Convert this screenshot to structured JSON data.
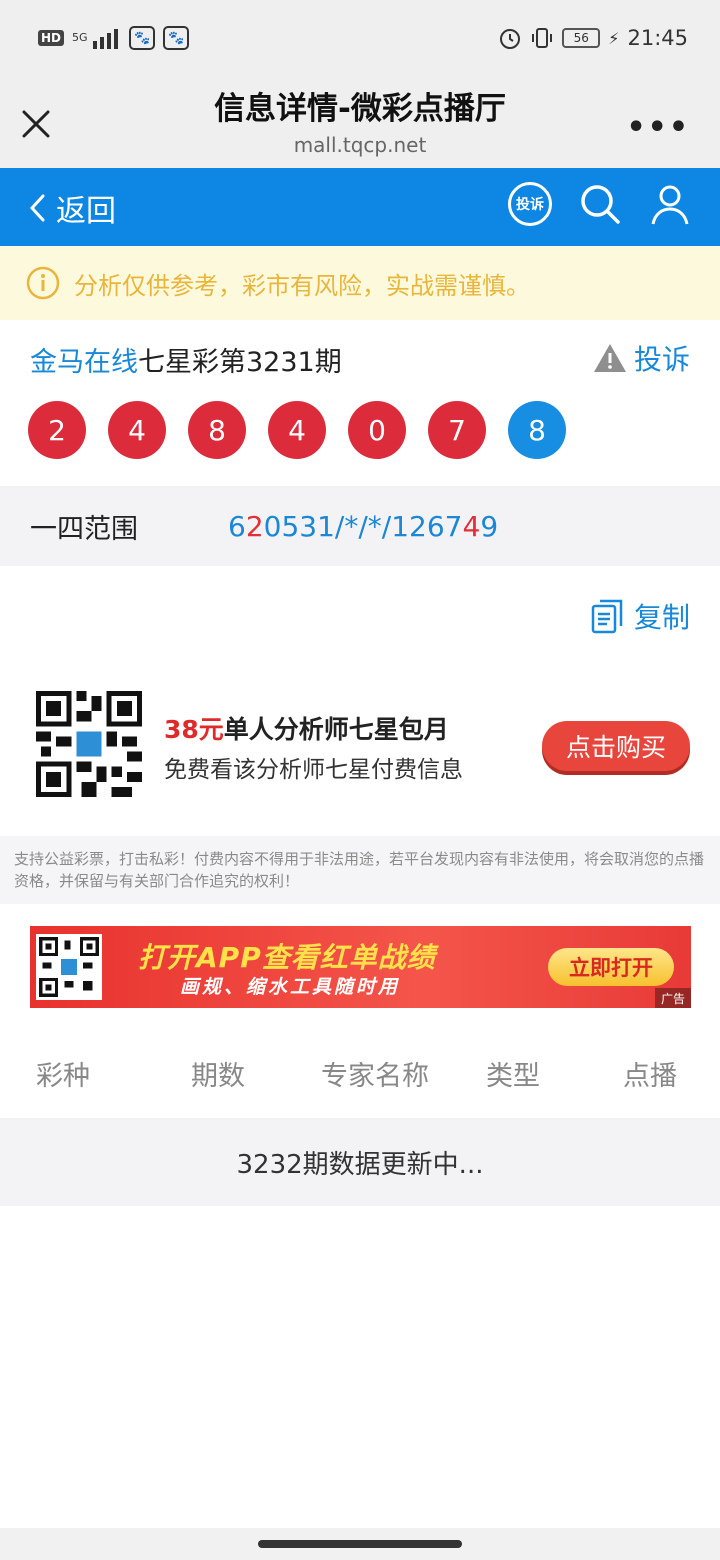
{
  "status_bar": {
    "hd": "HD",
    "network": "5G",
    "time": "21:45",
    "battery": "56"
  },
  "browser": {
    "title": "信息详情-微彩点播厅",
    "url": "mall.tqcp.net",
    "more": "•••"
  },
  "nav": {
    "back_label": "返回",
    "complain_icon_label": "投诉"
  },
  "notice": {
    "text": "分析仅供参考，彩市有风险，实战需谨慎。"
  },
  "lottery": {
    "source": "金马在线",
    "title": "七星彩第3231期",
    "report_label": "投诉",
    "balls": [
      {
        "value": "2",
        "color": "#dc2c3c"
      },
      {
        "value": "4",
        "color": "#dc2c3c"
      },
      {
        "value": "8",
        "color": "#dc2c3c"
      },
      {
        "value": "4",
        "color": "#dc2c3c"
      },
      {
        "value": "0",
        "color": "#dc2c3c"
      },
      {
        "value": "7",
        "color": "#dc2c3c"
      },
      {
        "value": "8",
        "color": "#178ee2"
      }
    ]
  },
  "range": {
    "label": "一四范围",
    "value_part1": "6",
    "value_part2": "2",
    "value_part3": "0531/*/*/1267",
    "value_part4": "4",
    "value_part5": "9"
  },
  "copy": {
    "label": "复制"
  },
  "promo": {
    "price": "38元",
    "title": "单人分析师七星包月",
    "subtitle": "免费看该分析师七星付费信息",
    "buy_label": "点击购买"
  },
  "disclaimer": "支持公益彩票，打击私彩！付费内容不得用于非法用途，若平台发现内容有非法使用，将会取消您的点播资格，并保留与有关部门合作追究的权利！",
  "banner": {
    "line1": "打开APP查看红单战绩",
    "line2": "画规、缩水工具随时用",
    "button": "立即打开",
    "ad_tag": "广告"
  },
  "table": {
    "headers": [
      "彩种",
      "期数",
      "专家名称",
      "类型",
      "点播"
    ],
    "update_text": "3232期数据更新中..."
  }
}
